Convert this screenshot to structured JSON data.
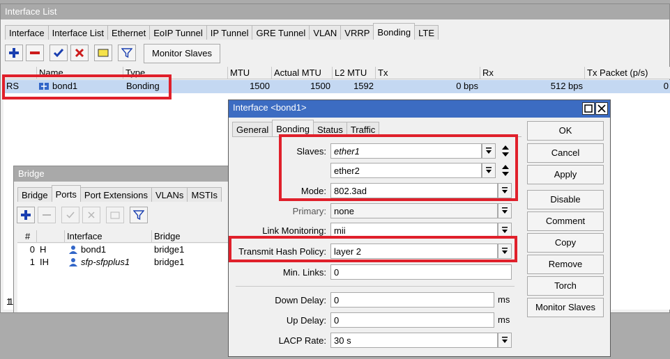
{
  "interface_list": {
    "title": "Interface List",
    "tabs": [
      "Interface",
      "Interface List",
      "Ethernet",
      "EoIP Tunnel",
      "IP Tunnel",
      "GRE Tunnel",
      "VLAN",
      "VRRP",
      "Bonding",
      "LTE"
    ],
    "selected_tab": "Bonding",
    "monitor_slaves_label": "Monitor Slaves",
    "columns": [
      "Name",
      "Type",
      "MTU",
      "Actual MTU",
      "L2 MTU",
      "Tx",
      "Rx",
      "Tx Packet (p/s)"
    ],
    "row": {
      "flags": "RS",
      "name": "bond1",
      "type": "Bonding",
      "mtu": "1500",
      "actual_mtu": "1500",
      "l2mtu": "1592",
      "tx": "0 bps",
      "rx": "512 bps",
      "tx_packet": "0"
    },
    "footer_count": "1"
  },
  "bridge": {
    "title": "Bridge",
    "tabs": [
      "Bridge",
      "Ports",
      "Port Extensions",
      "VLANs",
      "MSTIs"
    ],
    "selected_tab": "Ports",
    "columns": [
      "#",
      "Interface",
      "Bridge"
    ],
    "rows": [
      {
        "num": "0",
        "flag": "H",
        "iface": "bond1",
        "bridge": "bridge1",
        "italic": false
      },
      {
        "num": "1",
        "flag": "IH",
        "iface": "sfp-sfpplus1",
        "bridge": "bridge1",
        "italic": true
      }
    ]
  },
  "dialog": {
    "title": "Interface <bond1>",
    "tabs": [
      "General",
      "Bonding",
      "Status",
      "Traffic"
    ],
    "selected_tab": "Bonding",
    "labels": {
      "slaves": "Slaves:",
      "mode": "Mode:",
      "primary": "Primary:",
      "link_monitoring": "Link Monitoring:",
      "hash_policy": "Transmit Hash Policy:",
      "min_links": "Min. Links:",
      "down_delay": "Down Delay:",
      "up_delay": "Up Delay:",
      "lacp_rate": "LACP Rate:"
    },
    "values": {
      "slave1": "ether1",
      "slave2": "ether2",
      "mode": "802.3ad",
      "primary": "none",
      "link_monitoring": "mii",
      "hash_policy": "layer 2",
      "min_links": "0",
      "down_delay": "0",
      "up_delay": "0",
      "lacp_rate": "30 s"
    },
    "units": {
      "ms": "ms"
    },
    "buttons": [
      "OK",
      "Cancel",
      "Apply",
      "Disable",
      "Comment",
      "Copy",
      "Remove",
      "Torch",
      "Monitor Slaves"
    ]
  },
  "colors": {
    "highlight_box": "#e0202b",
    "active_title": "#3c6cc2",
    "selected_row": "#c4d8f2"
  }
}
